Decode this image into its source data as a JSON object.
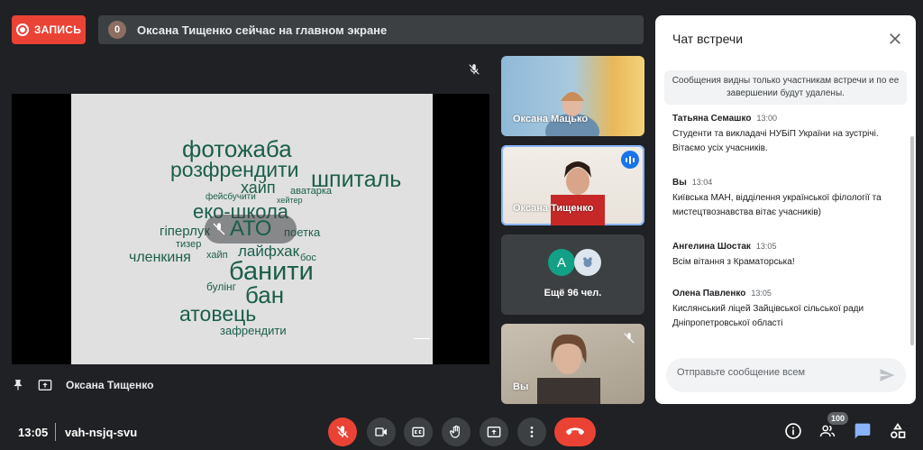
{
  "header": {
    "record_label": "ЗАПИСЬ",
    "presenter_count": "0",
    "presenter_text": "Оксана Тищенко сейчас на главном экране"
  },
  "slide": {
    "words": [
      "фотожаба",
      "розфрендити",
      "шпиталь",
      "хайп",
      "аватарка",
      "фейсбучити",
      "хейтер",
      "еко-школа",
      "гіперлук",
      "АТО",
      "поетка",
      "тизер",
      "лайфхак",
      "членкиня",
      "хайп",
      "бос",
      "банити",
      "булінг",
      "бан",
      "атовець",
      "зафрендити"
    ]
  },
  "stage": {
    "presenter_name": "Оксана Тищенко"
  },
  "tiles": {
    "t1": "Оксана Мацько",
    "t2": "Оксана Тищенко",
    "more_avatar": "А",
    "more_label": "Ещё 96 чел.",
    "you": "Вы"
  },
  "chat": {
    "title": "Чат встречи",
    "notice": "Сообщения видны только участникам встречи и по ее завершении будут удалены.",
    "messages": [
      {
        "sender": "Татьяна Семашко",
        "time": "13:00",
        "text": "Студенти та викладачі НУБіП України на зустрічі. Вітаємо усіх учасників."
      },
      {
        "sender": "Вы",
        "time": "13:04",
        "text": "Київська МАН, відділення української філології та мистецтвознавства вітає учасників)"
      },
      {
        "sender": "Ангелина Шостак",
        "time": "13:05",
        "text": "Всім вітання з Краматорська!"
      },
      {
        "sender": "Олена Павленко",
        "time": "13:05",
        "text": "Кислянський ліцей Зайцівської сільської ради Дніпропетровської області"
      }
    ],
    "input_placeholder": "Отправьте сообщение всем"
  },
  "footer": {
    "time": "13:05",
    "meeting_code": "vah-nsjq-svu",
    "participants_badge": "100"
  },
  "icons": {
    "mic_off": "mic-off-icon",
    "camera": "videocam-icon",
    "captions": "closed-caption-icon",
    "hand": "raise-hand-icon",
    "present": "present-screen-icon",
    "more": "more-vert-icon",
    "hangup": "call-end-icon",
    "info": "info-icon",
    "people": "people-icon",
    "chat": "chat-icon",
    "activities": "activities-icon"
  },
  "colors": {
    "accent_red": "#ea4335",
    "accent_blue": "#8ab4f8",
    "chat_icon_blue": "#8ab4f8",
    "slide_text": "#1b5e4a"
  }
}
